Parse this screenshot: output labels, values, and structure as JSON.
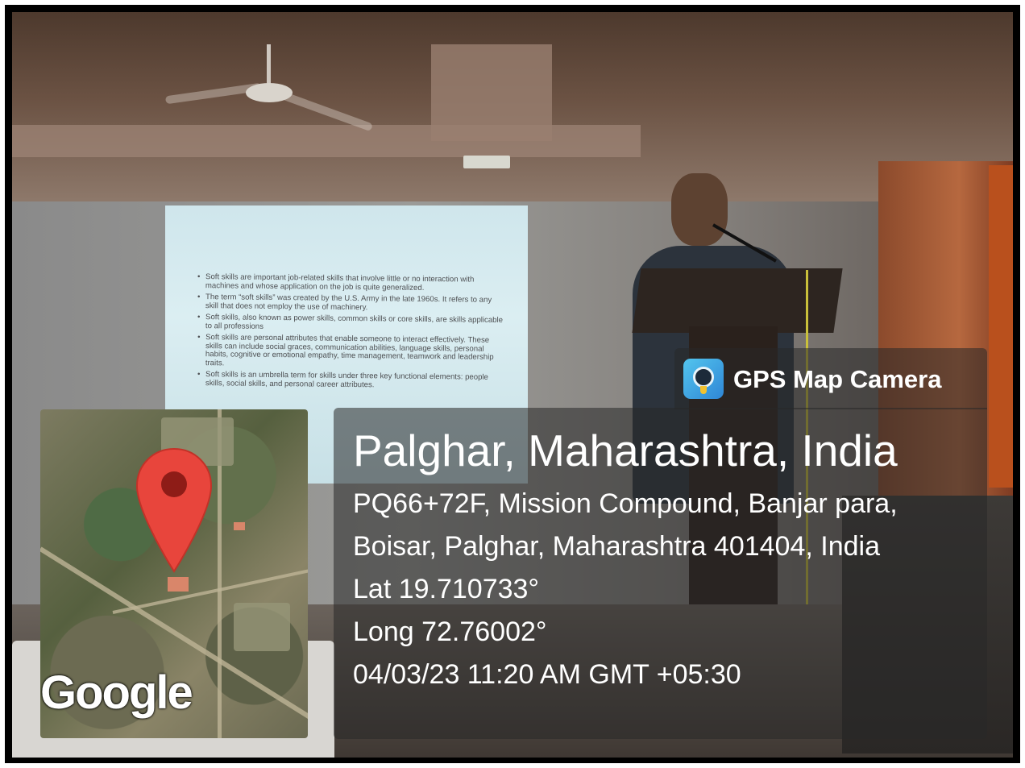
{
  "app": {
    "name": "GPS Map Camera",
    "logo_icon": "gps-map-camera-logo"
  },
  "location": {
    "title": "Palghar, Maharashtra, India",
    "address_line1": "PQ66+72F, Mission Compound, Banjar para,",
    "address_line2": "Boisar, Palghar, Maharashtra 401404, India",
    "latitude": "Lat 19.710733°",
    "longitude": "Long 72.76002°",
    "timestamp": "04/03/23 11:20 AM GMT +05:30"
  },
  "map": {
    "provider_logo": "Google",
    "marker_icon": "map-pin-icon",
    "marker_color": "#e8453c"
  },
  "slide": {
    "bullets": [
      "Soft skills are important job-related skills that involve little or no interaction with machines and whose application on the job is quite generalized.",
      "The term “soft skills” was created by the U.S. Army in the late 1960s. It refers to any skill that does not employ the use of machinery.",
      "Soft skills, also known as power skills, common skills or core skills, are skills applicable to all professions",
      "Soft skills are personal attributes that enable someone to interact effectively. These skills can include social graces, communication abilities, language skills, personal habits, cognitive or emotional empathy, time management, teamwork and leadership traits.",
      "Soft skills is an umbrella term for skills under three key functional elements: people skills, social skills, and personal career attributes."
    ]
  }
}
